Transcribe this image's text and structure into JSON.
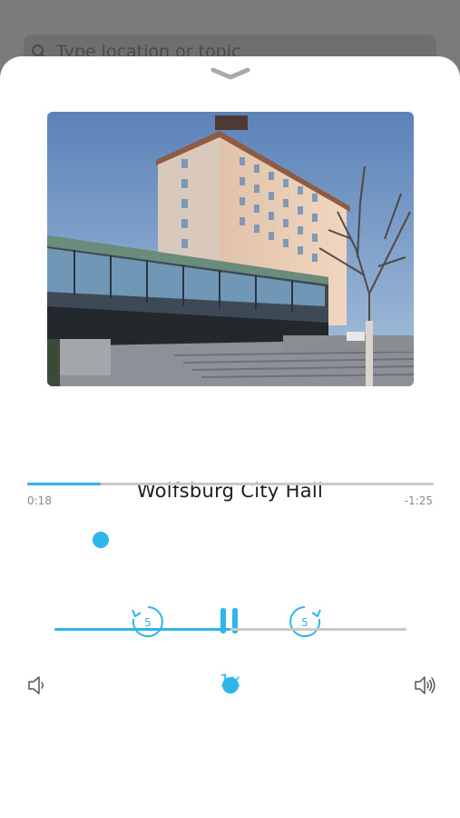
{
  "search": {
    "placeholder": "Type location or topic"
  },
  "player": {
    "title": "Wolfsburg City Hall",
    "elapsed": "0:18",
    "remaining": "-1:25",
    "progress_fraction": 0.18,
    "volume_fraction": 0.5,
    "rewind_seconds": "5",
    "forward_seconds": "5",
    "speed": "1x"
  },
  "icons": {
    "search": "search-icon",
    "collapse": "chevron-down-icon",
    "rewind": "rewind-5-icon",
    "pause": "pause-icon",
    "forward": "forward-5-icon",
    "volume_low": "volume-low-icon",
    "volume_high": "volume-high-icon"
  },
  "colors": {
    "accent": "#2db5ec",
    "overlay": "#7b7b7b",
    "sheet": "#ffffff"
  }
}
